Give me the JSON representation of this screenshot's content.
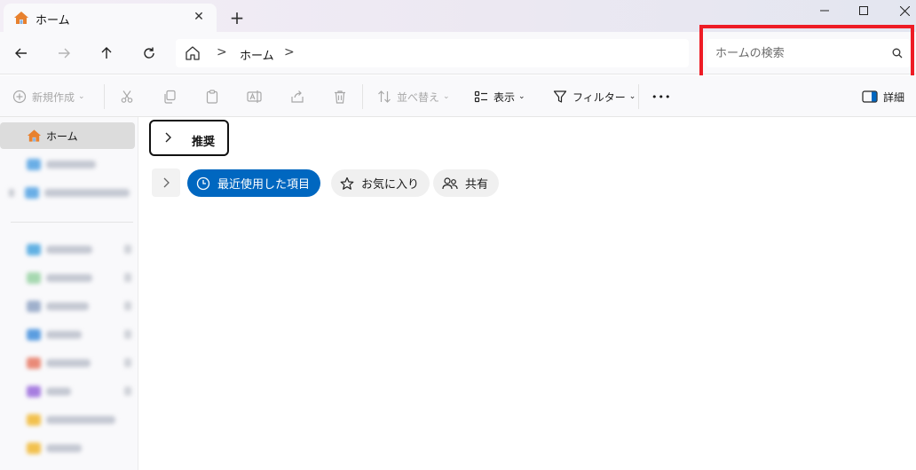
{
  "window": {
    "tab_title": "ホーム",
    "tab_close_glyph": "✕",
    "new_tab_glyph": "+",
    "minimize_glyph": "—",
    "maximize_glyph": "☐",
    "close_glyph": "✕"
  },
  "navigation": {
    "back_icon": "arrow-left-icon",
    "forward_icon": "arrow-right-icon",
    "up_icon": "arrow-up-icon",
    "refresh_icon": "refresh-icon",
    "breadcrumb": [
      "ホーム"
    ],
    "chevron_glyph": ">"
  },
  "search": {
    "placeholder": "ホームの検索",
    "value": ""
  },
  "command_bar": {
    "new_label": "新規作成",
    "sort_label": "並べ替え",
    "view_label": "表示",
    "filter_label": "フィルター",
    "more_glyph": "•••",
    "details_label": "詳細",
    "caret_glyph": "⌄"
  },
  "sidebar": {
    "home_label": "ホーム"
  },
  "content": {
    "section_title": "推奨",
    "filters": [
      {
        "label": "最近使用した項目",
        "icon": "clock-icon",
        "active": true
      },
      {
        "label": "お気に入り",
        "icon": "star-icon",
        "active": false
      },
      {
        "label": "共有",
        "icon": "people-icon",
        "active": false
      }
    ]
  },
  "colors": {
    "accent": "#0067c0",
    "highlight_box": "#ee1c25",
    "home_icon": "#e8812e"
  }
}
